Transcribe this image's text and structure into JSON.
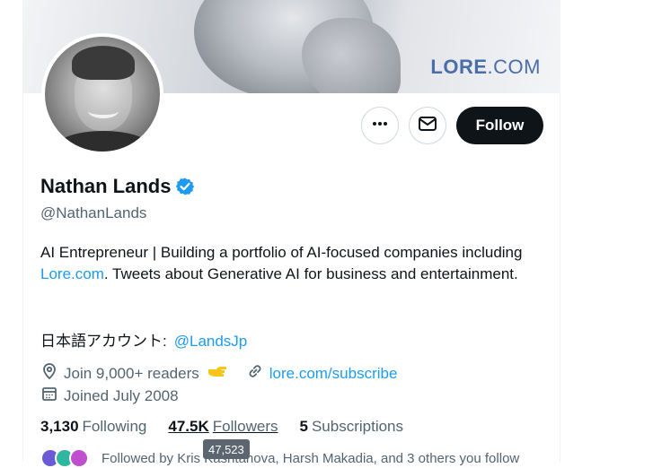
{
  "banner": {
    "brand_bold": "LORE",
    "brand_thin": ".COM"
  },
  "actions": {
    "follow_label": "Follow"
  },
  "profile": {
    "name": "Nathan Lands",
    "handle": "@NathanLands",
    "bio_part1": "AI Entrepreneur | Building a portfolio of AI-focused companies including ",
    "bio_link": "Lore.com",
    "bio_part2": ". Tweets about Generative AI for business and entertainment.",
    "jp_label": "日本語アカウント:",
    "jp_link": "@LandsJp",
    "location": "Join 9,000+ readers",
    "website": "lore.com/subscribe",
    "joined": "Joined July 2008"
  },
  "stats": {
    "following_count": "3,130",
    "following_label": "Following",
    "followers_count": "47.5K",
    "followers_label": "Followers",
    "subscriptions_count": "5",
    "subscriptions_label": "Subscriptions"
  },
  "tooltip": {
    "text": "47,523"
  },
  "followed_by": {
    "text": "Followed by Kris Kashtanova, Harsh Makadia, and 3 others you follow"
  },
  "colors": {
    "accent": "#1d9bf0",
    "text": "#0f1419",
    "muted": "#536471",
    "brand": "#4a6ea8"
  }
}
